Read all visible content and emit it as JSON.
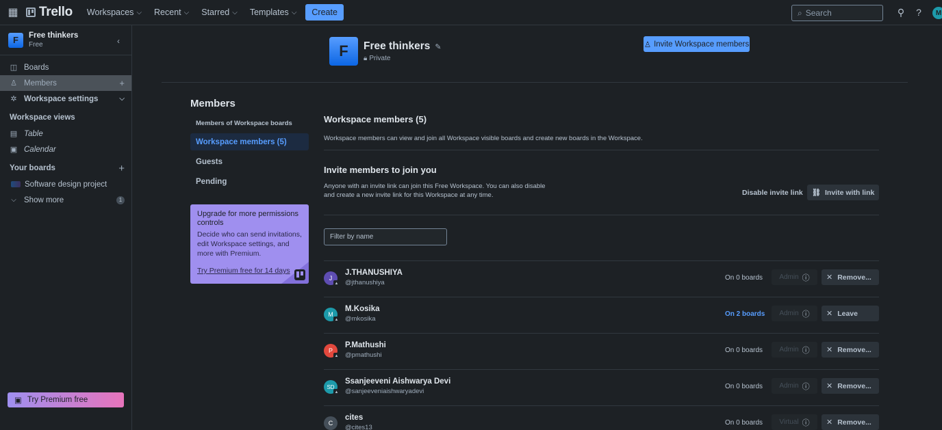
{
  "topbar": {
    "logo": "Trello",
    "nav": [
      {
        "label": "Workspaces"
      },
      {
        "label": "Recent"
      },
      {
        "label": "Starred"
      },
      {
        "label": "Templates"
      }
    ],
    "create_label": "Create",
    "search_placeholder": "Search",
    "avatar_initial": "M"
  },
  "sidebar": {
    "workspace_name": "Free thinkers",
    "workspace_plan": "Free",
    "workspace_initial": "F",
    "items": [
      {
        "label": "Boards"
      },
      {
        "label": "Members"
      },
      {
        "label": "Workspace settings"
      }
    ],
    "views_header": "Workspace views",
    "views": [
      {
        "label": "Table"
      },
      {
        "label": "Calendar"
      }
    ],
    "boards_header": "Your boards",
    "boards": [
      {
        "label": "Software design project"
      }
    ],
    "show_more_label": "Show more",
    "show_more_count": "1",
    "premium_label": "Try Premium free"
  },
  "header": {
    "initial": "F",
    "title": "Free thinkers",
    "visibility": "Private",
    "invite_button": "Invite Workspace members"
  },
  "members_nav": {
    "title": "Members",
    "items": [
      {
        "label": "Members of Workspace boards"
      },
      {
        "label": "Workspace members (5)"
      },
      {
        "label": "Guests"
      },
      {
        "label": "Pending"
      }
    ]
  },
  "upgrade": {
    "title": "Upgrade for more permissions controls",
    "body": "Decide who can send invitations, edit Workspace settings, and more with Premium.",
    "link": "Try Premium free for 14 days"
  },
  "workspace_members": {
    "title": "Workspace members (5)",
    "description": "Workspace members can view and join all Workspace visible boards and create new boards in the Workspace.",
    "invite_title": "Invite members to join you",
    "invite_text": "Anyone with an invite link can join this Free Workspace. You can also disable and create a new invite link for this Workspace at any time.",
    "disable_link": "Disable invite link",
    "invite_with_link": "Invite with link",
    "filter_placeholder": "Filter by name"
  },
  "members": [
    {
      "initials": "J",
      "name": "J.THANUSHIYA",
      "handle": "@jthanushiya",
      "boards": "On 0 boards",
      "role": "Admin",
      "action": "Remove...",
      "color": "#5e4db2"
    },
    {
      "initials": "M",
      "name": "M.Kosika",
      "handle": "@mkosika",
      "boards": "On 2 boards",
      "role": "Admin",
      "action": "Leave",
      "color": "#1d9aaa"
    },
    {
      "initials": "P",
      "name": "P.Mathushi",
      "handle": "@pmathushi",
      "boards": "On 0 boards",
      "role": "Admin",
      "action": "Remove...",
      "color": "#e2483d"
    },
    {
      "initials": "SD",
      "name": "Ssanjeeveni Aishwarya Devi",
      "handle": "@sanjeeveniaishwaryadevi",
      "boards": "On 0 boards",
      "role": "Admin",
      "action": "Remove...",
      "color": "#1d9aaa"
    },
    {
      "initials": "C",
      "name": "cites",
      "handle": "@cites13",
      "boards": "On 0 boards",
      "role": "Virtual",
      "action": "Remove...",
      "color": "#454f59"
    }
  ]
}
